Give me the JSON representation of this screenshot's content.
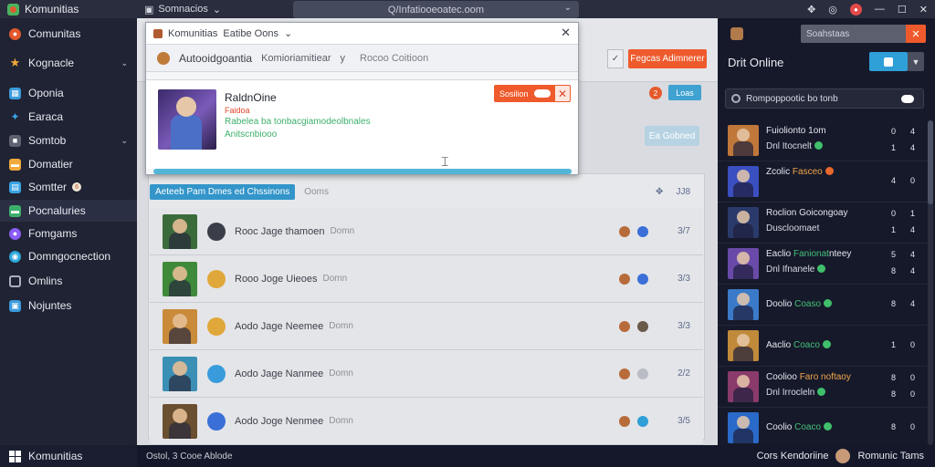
{
  "titlebar": {
    "app_name": "Komunitias",
    "menu_label": "Somnacios",
    "address": "Q/Infatiooeoatec.oom"
  },
  "sidebar": {
    "items": [
      {
        "label": "Comunitas",
        "icon": "chrome-icon",
        "color": "#e2572b"
      },
      {
        "label": "Kognacle",
        "icon": "star-icon",
        "color": "#f2a93b",
        "caret": true
      },
      {
        "label": "Oponia",
        "icon": "grid-icon",
        "color": "#3a9bdc"
      },
      {
        "label": "Earaca",
        "icon": "bird-icon",
        "color": "#3aa3e3"
      },
      {
        "label": "Somtob",
        "icon": "box-icon",
        "color": "#5d6170",
        "caret": true
      },
      {
        "label": "Domatier",
        "icon": "folder-icon",
        "color": "#f2a93b"
      },
      {
        "label": "Somtter",
        "icon": "chat-icon",
        "color": "#3aa3e3",
        "badge": "6"
      },
      {
        "label": "Pocnaluries",
        "icon": "tag-icon",
        "color": "#3db06b"
      },
      {
        "label": "Fomgams",
        "icon": "twitch-icon",
        "color": "#8b5cf6"
      },
      {
        "label": "Domngocnection",
        "icon": "steam-icon",
        "color": "#2aa6d9"
      },
      {
        "label": "Omlins",
        "icon": "monitor-icon",
        "color": "#aab0bf"
      },
      {
        "label": "Nojuntes",
        "icon": "window-icon",
        "color": "#3a9bdc"
      }
    ]
  },
  "main": {
    "header_button": "Fegcas Adimnerer",
    "header_check": "✓",
    "notif_count": "2",
    "notif_button": "Loas",
    "side_button": "Ea Gobned",
    "filter_pill": "Aeteeb Pam Dmes ed Chssinons",
    "filter_extra": "Ooms",
    "filter_count": "JJ8",
    "rows": [
      {
        "title": "Rooc Jage thamoen",
        "sub": "Domn",
        "count": "3/7",
        "thumb": "#3b6b3a",
        "gicon": "#3a3e48"
      },
      {
        "title": "Rooo Joge Uieoes",
        "sub": "Domn",
        "count": "3/3",
        "thumb": "#3f8a3a",
        "gicon": "#e0a83a"
      },
      {
        "title": "Aodo Jage Neemee",
        "sub": "Domn",
        "count": "3/3",
        "thumb": "#c98a3a",
        "gicon": "#e0a83a"
      },
      {
        "title": "Aodo Jage Nanmee",
        "sub": "Domn",
        "count": "2/2",
        "thumb": "#3a8fb5",
        "gicon": "#3a9bdc"
      },
      {
        "title": "Aodo Joge Nenmee",
        "sub": "Domn",
        "count": "3/5",
        "thumb": "#6a5030",
        "gicon": "#3a6fd8"
      }
    ]
  },
  "dialog": {
    "tab_label": "Komunitias",
    "tab_extra": "Eatibe Oons",
    "toolbar_title": "Autooidgoantia",
    "toolbar_search": "Komioriamitiear",
    "toolbar_search_caret": "y",
    "toolbar_muted": "Rocoo Coitioon",
    "card_name": "RaldnOine",
    "card_red": "Faidoa",
    "card_green1": "Rabelea ba tonbacgiamodeolbnales",
    "card_green2": "Anitscnbiooo",
    "toggle_label": "Sosilion",
    "progress": 1.0
  },
  "rpanel": {
    "search_placeholder": "Soahstaas",
    "title": "Drit Online",
    "bar_text": "Rompoppootic bo tonb",
    "items": [
      {
        "l1a": "Fuiolionto",
        "l1b": "",
        "l1c": " 1om",
        "l2": "Dnl Itocnelt",
        "dot": "g",
        "n1": [
          "0",
          "4"
        ],
        "n2": [
          "1",
          "4"
        ],
        "av": "#c0783a"
      },
      {
        "l1a": "Zcolic ",
        "l1b": "",
        "l1c": "Fasceo",
        "l2": "",
        "dot": "o",
        "n1": [
          "4",
          "0"
        ],
        "n2": null,
        "av": "#3a4fc0"
      },
      {
        "l1a": "Roclion Goicongoay",
        "l1b": "",
        "l1c": "",
        "l2": "Duscloomaet",
        "dot": "",
        "n1": [
          "0",
          "1"
        ],
        "n2": [
          "1",
          "4"
        ],
        "av": "#2a3a6b"
      },
      {
        "l1a": "Eaclio ",
        "l1b": "Fanionat",
        "l1c": "nteey",
        "l2": "Dnl Ifnanele",
        "dot": "g",
        "n1": [
          "5",
          "4"
        ],
        "n2": [
          "8",
          "4"
        ],
        "av": "#6a4aa8"
      },
      {
        "l1a": "Doolio ",
        "l1b": "Coaso",
        "l1c": "",
        "l2": "",
        "dot": "g",
        "n1": [
          "8",
          "4"
        ],
        "n2": null,
        "av": "#3a7ac8"
      },
      {
        "l1a": "Aaclio ",
        "l1b": "Coaco",
        "l1c": "",
        "l2": "",
        "dot": "g",
        "n1": [
          "1",
          "0"
        ],
        "n2": null,
        "av": "#c08a3a"
      },
      {
        "l1a": "Coolioo ",
        "l1b": "Faro noftaoy",
        "l1c": "",
        "l2": "Dnl Irrocleln",
        "dot": "g",
        "n1": [
          "8",
          "0"
        ],
        "n2": [
          "8",
          "0"
        ],
        "av": "#8a3a6b"
      },
      {
        "l1a": "Coolio ",
        "l1b": "Coaco",
        "l1c": "",
        "l2": "",
        "dot": "g",
        "n1": [
          "8",
          "0"
        ],
        "n2": null,
        "av": "#2a6ac8"
      }
    ]
  },
  "taskbar": {
    "app_name": "Komunitias",
    "status": "Ostol, 3 Cooe Ablode",
    "right_label": "Cors Kendoriine",
    "user": "Romunic Tams"
  },
  "colors": {
    "accent_blue": "#3fa2d1",
    "accent_orange": "#ef5a2c",
    "online_green": "#3fbf6b"
  }
}
